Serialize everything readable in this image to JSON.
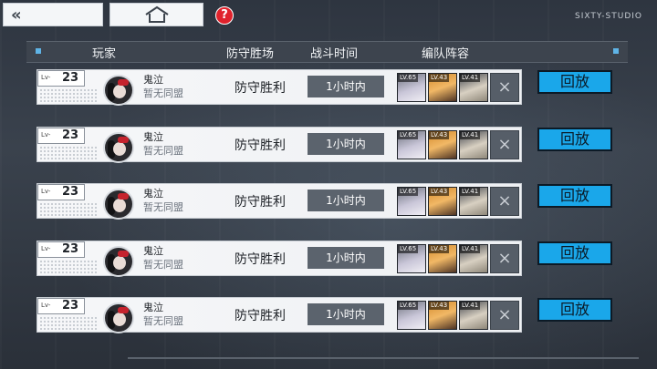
{
  "topbar": {
    "back_glyph": "«",
    "help_glyph": "?",
    "studio": "SIXTY-STUDIO"
  },
  "header": {
    "player": "玩家",
    "defense_wins": "防守胜场",
    "battle_time": "战斗时间",
    "lineup": "编队阵容"
  },
  "colors": {
    "accent": "#1aa7ea",
    "help_red": "#e0222c",
    "marker": "#5fb4e6"
  },
  "records": [
    {
      "lv_prefix": "Lv-",
      "level": "23",
      "name": "鬼泣",
      "alliance": "暂无同盟",
      "result": "防守胜利",
      "time": "1小时内",
      "units": [
        {
          "lv": "LV.65"
        },
        {
          "lv": "LV.43"
        },
        {
          "lv": "LV.41"
        }
      ],
      "empty_slot": "×",
      "replay": "回放"
    },
    {
      "lv_prefix": "Lv-",
      "level": "23",
      "name": "鬼泣",
      "alliance": "暂无同盟",
      "result": "防守胜利",
      "time": "1小时内",
      "units": [
        {
          "lv": "LV.65"
        },
        {
          "lv": "LV.43"
        },
        {
          "lv": "LV.41"
        }
      ],
      "empty_slot": "×",
      "replay": "回放"
    },
    {
      "lv_prefix": "Lv-",
      "level": "23",
      "name": "鬼泣",
      "alliance": "暂无同盟",
      "result": "防守胜利",
      "time": "1小时内",
      "units": [
        {
          "lv": "LV.65"
        },
        {
          "lv": "LV.43"
        },
        {
          "lv": "LV.41"
        }
      ],
      "empty_slot": "×",
      "replay": "回放"
    },
    {
      "lv_prefix": "Lv-",
      "level": "23",
      "name": "鬼泣",
      "alliance": "暂无同盟",
      "result": "防守胜利",
      "time": "1小时内",
      "units": [
        {
          "lv": "LV.65"
        },
        {
          "lv": "LV.43"
        },
        {
          "lv": "LV.41"
        }
      ],
      "empty_slot": "×",
      "replay": "回放"
    },
    {
      "lv_prefix": "Lv-",
      "level": "23",
      "name": "鬼泣",
      "alliance": "暂无同盟",
      "result": "防守胜利",
      "time": "1小时内",
      "units": [
        {
          "lv": "LV.65"
        },
        {
          "lv": "LV.43"
        },
        {
          "lv": "LV.41"
        }
      ],
      "empty_slot": "×",
      "replay": "回放"
    }
  ]
}
